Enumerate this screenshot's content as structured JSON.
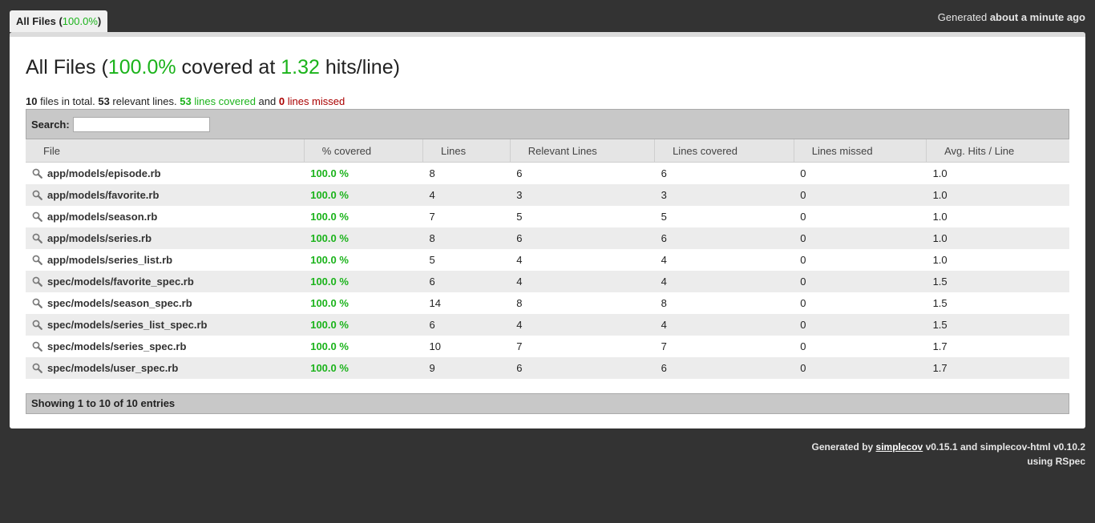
{
  "tab": {
    "label_prefix": "All Files (",
    "pct": "100.0%",
    "label_suffix": ")"
  },
  "header": {
    "generated_prefix": "Generated ",
    "generated_time": "about a minute ago"
  },
  "title": {
    "prefix": "All Files (",
    "coverage": "100.0%",
    "middle": " covered at ",
    "hits": "1.32",
    "suffix": " hits/line)"
  },
  "summary": {
    "files": "10",
    "files_text": " files in total. ",
    "relevant": "53",
    "relevant_text": " relevant lines. ",
    "covered": "53",
    "covered_text": " lines covered",
    "and_text": " and ",
    "missed": "0",
    "missed_text": " lines missed"
  },
  "search": {
    "label": "Search:",
    "value": ""
  },
  "table": {
    "headers": [
      "File",
      "% covered",
      "Lines",
      "Relevant Lines",
      "Lines covered",
      "Lines missed",
      "Avg. Hits / Line"
    ],
    "rows": [
      [
        "app/models/episode.rb",
        "100.0 %",
        "8",
        "6",
        "6",
        "0",
        "1.0"
      ],
      [
        "app/models/favorite.rb",
        "100.0 %",
        "4",
        "3",
        "3",
        "0",
        "1.0"
      ],
      [
        "app/models/season.rb",
        "100.0 %",
        "7",
        "5",
        "5",
        "0",
        "1.0"
      ],
      [
        "app/models/series.rb",
        "100.0 %",
        "8",
        "6",
        "6",
        "0",
        "1.0"
      ],
      [
        "app/models/series_list.rb",
        "100.0 %",
        "5",
        "4",
        "4",
        "0",
        "1.0"
      ],
      [
        "spec/models/favorite_spec.rb",
        "100.0 %",
        "6",
        "4",
        "4",
        "0",
        "1.5"
      ],
      [
        "spec/models/season_spec.rb",
        "100.0 %",
        "14",
        "8",
        "8",
        "0",
        "1.5"
      ],
      [
        "spec/models/series_list_spec.rb",
        "100.0 %",
        "6",
        "4",
        "4",
        "0",
        "1.5"
      ],
      [
        "spec/models/series_spec.rb",
        "100.0 %",
        "10",
        "7",
        "7",
        "0",
        "1.7"
      ],
      [
        "spec/models/user_spec.rb",
        "100.0 %",
        "9",
        "6",
        "6",
        "0",
        "1.7"
      ]
    ]
  },
  "footer": {
    "entries": "Showing 1 to 10 of 10 entries"
  },
  "credits": {
    "line1_prefix": "Generated by ",
    "link": "simplecov",
    "line1_suffix": " v0.15.1 and simplecov-html v0.10.2",
    "line2": "using RSpec"
  },
  "colors": {
    "covered": "#1bb31b",
    "missed": "#aa0000",
    "background": "#333333"
  },
  "icons": {
    "file_row": "magnifier-icon"
  }
}
